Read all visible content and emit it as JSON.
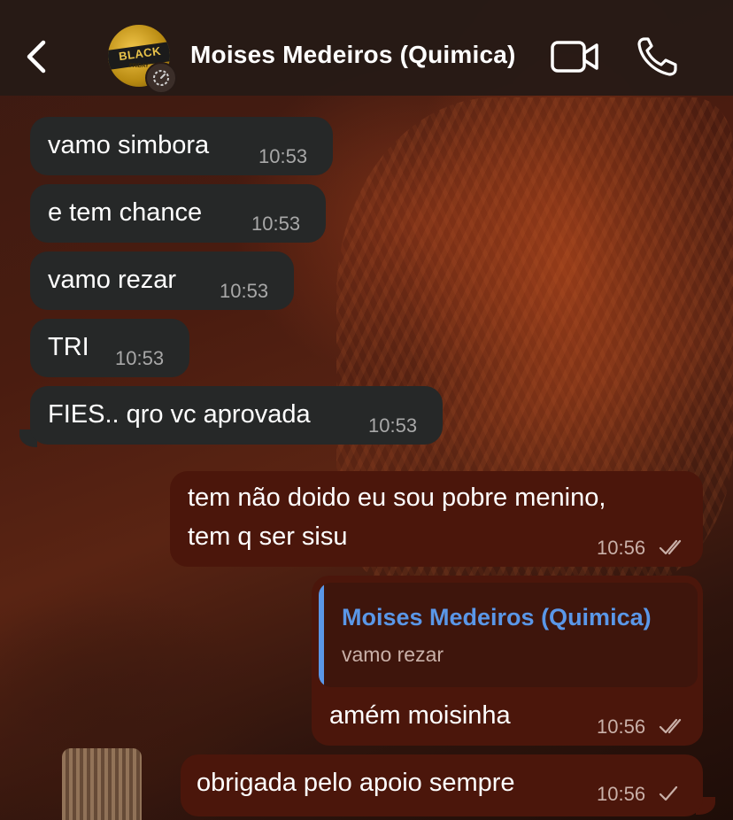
{
  "header": {
    "contact_name": "Moises Medeiros (Quimica)",
    "avatar_text_main": "BLACK",
    "avatar_text_sub": "FRIDAY"
  },
  "messages": [
    {
      "direction": "incoming",
      "text": "vamo simbora",
      "time": "10:53"
    },
    {
      "direction": "incoming",
      "text": "e tem chance",
      "time": "10:53"
    },
    {
      "direction": "incoming",
      "text": "vamo rezar",
      "time": "10:53"
    },
    {
      "direction": "incoming",
      "text": "TRI",
      "time": "10:53"
    },
    {
      "direction": "incoming",
      "text": "FIES.. qro vc aprovada",
      "time": "10:53"
    },
    {
      "direction": "outgoing",
      "lines": [
        "tem não doido eu sou pobre menino,",
        "tem q ser sisu"
      ],
      "time": "10:56",
      "status": "read"
    },
    {
      "direction": "outgoing",
      "reply_to": {
        "name": "Moises Medeiros (Quimica)",
        "text": "vamo rezar"
      },
      "text": "amém moisinha",
      "time": "10:56",
      "status": "read"
    },
    {
      "direction": "outgoing",
      "text": "obrigada pelo apoio sempre",
      "time": "10:56",
      "status": "sent"
    }
  ],
  "colors": {
    "incoming_bubble": "#262828",
    "outgoing_bubble": "#4b160b",
    "reply_accent": "#5a97e8",
    "header_bg": "#261a16"
  }
}
